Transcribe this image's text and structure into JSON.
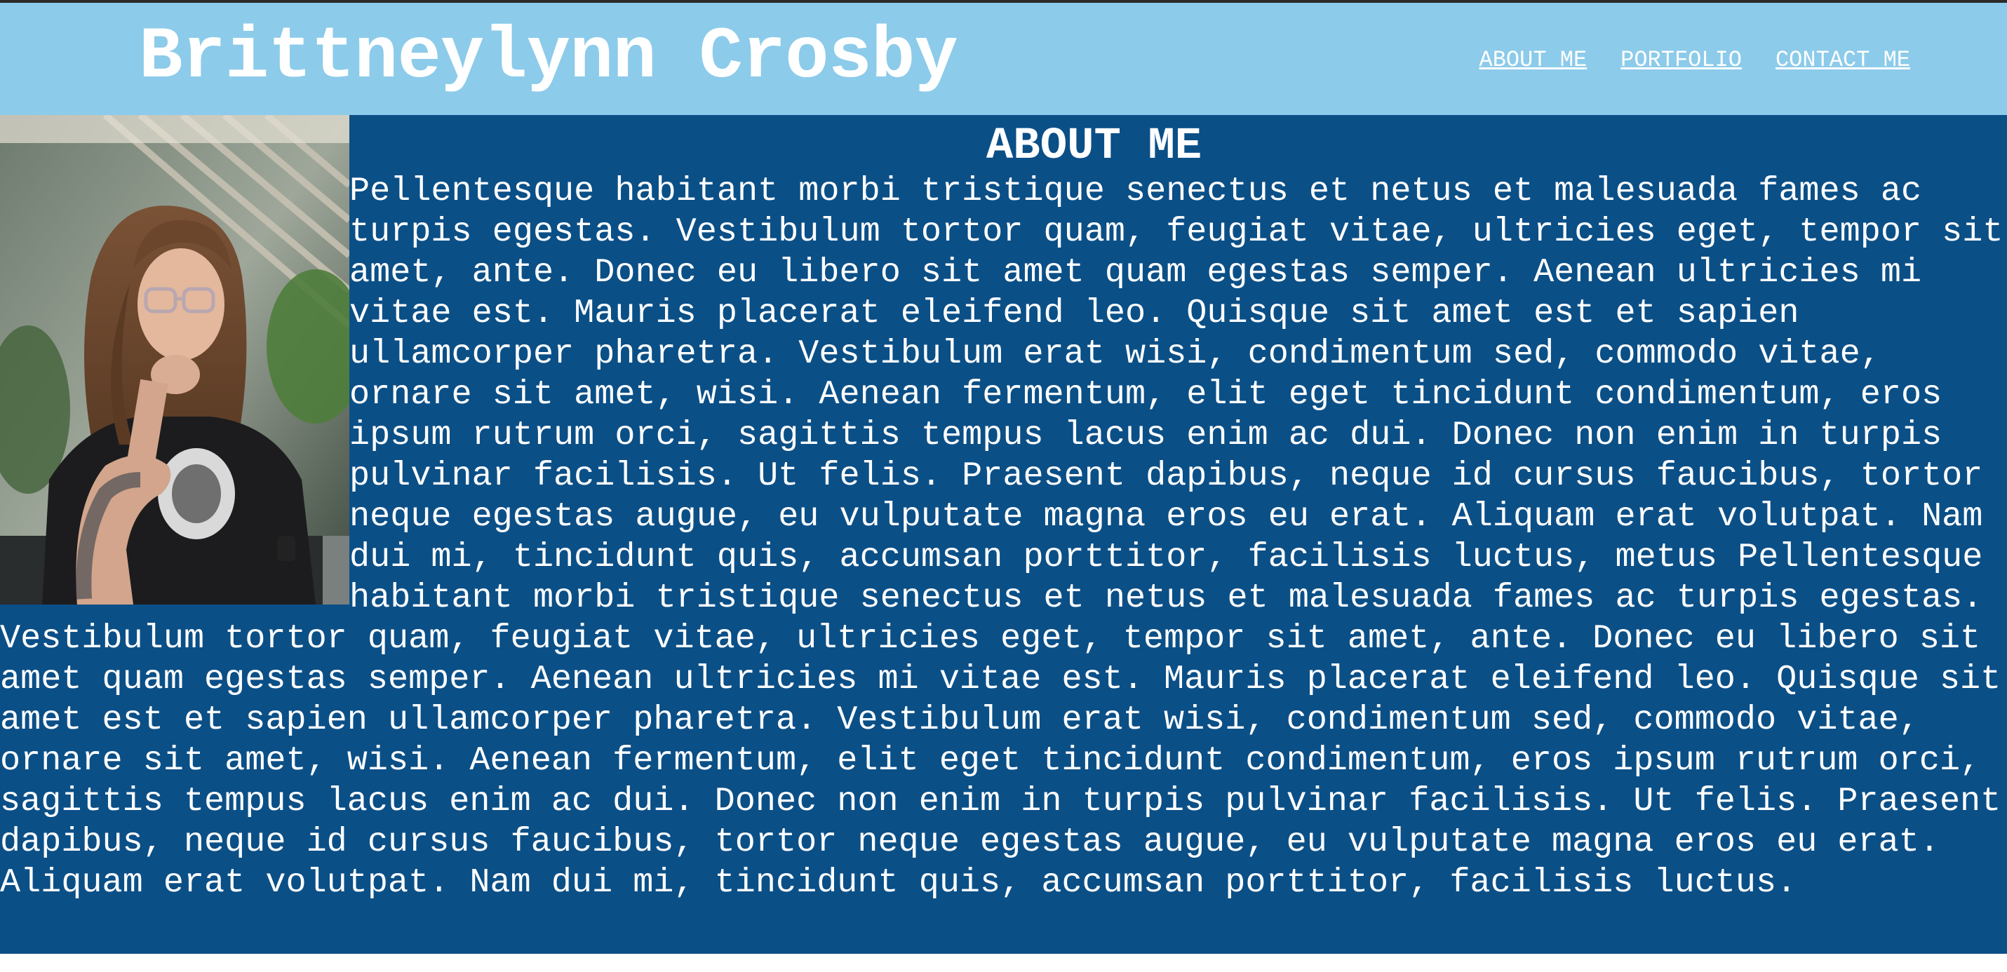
{
  "header": {
    "title": "Brittneylynn Crosby",
    "background_color": "#8ccbea",
    "nav": [
      {
        "label": "ABOUT ME"
      },
      {
        "label": "PORTFOLIO"
      },
      {
        "label": "CONTACT ME"
      }
    ]
  },
  "about": {
    "heading": "ABOUT ME",
    "background_color": "#0b4f87",
    "photo_icon": "profile-photo",
    "body": "Pellentesque habitant morbi tristique senectus et netus et malesuada fames ac turpis egestas. Vestibulum tortor quam, feugiat vitae, ultricies eget, tempor sit amet, ante. Donec eu libero sit amet quam egestas semper. Aenean ultricies mi vitae est. Mauris placerat eleifend leo. Quisque sit amet est et sapien ullamcorper pharetra. Vestibulum erat wisi, condimentum sed, commodo vitae, ornare sit amet, wisi. Aenean fermentum, elit eget tincidunt condimentum, eros ipsum rutrum orci, sagittis tempus lacus enim ac dui. Donec non enim in turpis pulvinar facilisis. Ut felis. Praesent dapibus, neque id cursus faucibus, tortor neque egestas augue, eu vulputate magna eros eu erat. Aliquam erat volutpat. Nam dui mi, tincidunt quis, accumsan porttitor, facilisis luctus, metus Pellentesque habitant morbi tristique senectus et netus et malesuada fames ac turpis egestas. Vestibulum tortor quam, feugiat vitae, ultricies eget, tempor sit amet, ante. Donec eu libero sit amet quam egestas semper. Aenean ultricies mi vitae est. Mauris placerat eleifend leo. Quisque sit amet est et sapien ullamcorper pharetra. Vestibulum erat wisi, condimentum sed, commodo vitae, ornare sit amet, wisi. Aenean fermentum, elit eget tincidunt condimentum, eros ipsum rutrum orci, sagittis tempus lacus enim ac dui. Donec non enim in turpis pulvinar facilisis. Ut felis. Praesent dapibus, neque id cursus faucibus, tortor neque egestas augue, eu vulputate magna eros eu erat. Aliquam erat volutpat. Nam dui mi, tincidunt quis, accumsan porttitor, facilisis luctus."
  }
}
